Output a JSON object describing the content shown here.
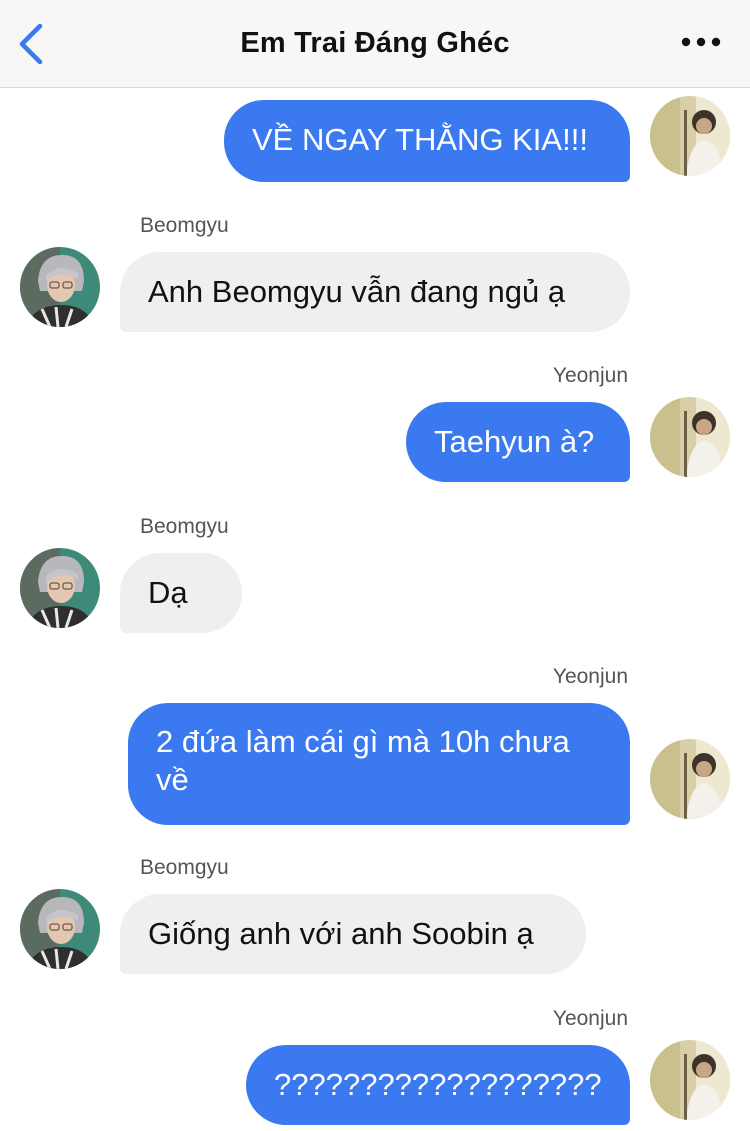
{
  "header": {
    "title": "Em Trai Đáng Ghéc",
    "back_icon": "chevron-left-icon",
    "more_icon": "more-horizontal-icon",
    "accent": "#3a79f0"
  },
  "colors": {
    "outgoing_bubble": "#3a79f0",
    "incoming_bubble": "#efeff2"
  },
  "messages": [
    {
      "sender": "",
      "direction": "out",
      "text": "VỀ NGAY THẰNG KIA!!!"
    },
    {
      "sender": "Beomgyu",
      "direction": "in",
      "text": "Anh Beomgyu vẫn đang ngủ ạ"
    },
    {
      "sender": "Yeonjun",
      "direction": "out",
      "text": "Taehyun à?"
    },
    {
      "sender": "Beomgyu",
      "direction": "in",
      "text": "Dạ"
    },
    {
      "sender": "Yeonjun",
      "direction": "out",
      "text": "2 đứa làm cái gì mà 10h chưa về"
    },
    {
      "sender": "Beomgyu",
      "direction": "in",
      "text": "Giống anh với anh Soobin ạ"
    },
    {
      "sender": "Yeonjun",
      "direction": "out",
      "text": "???????????????????"
    }
  ]
}
